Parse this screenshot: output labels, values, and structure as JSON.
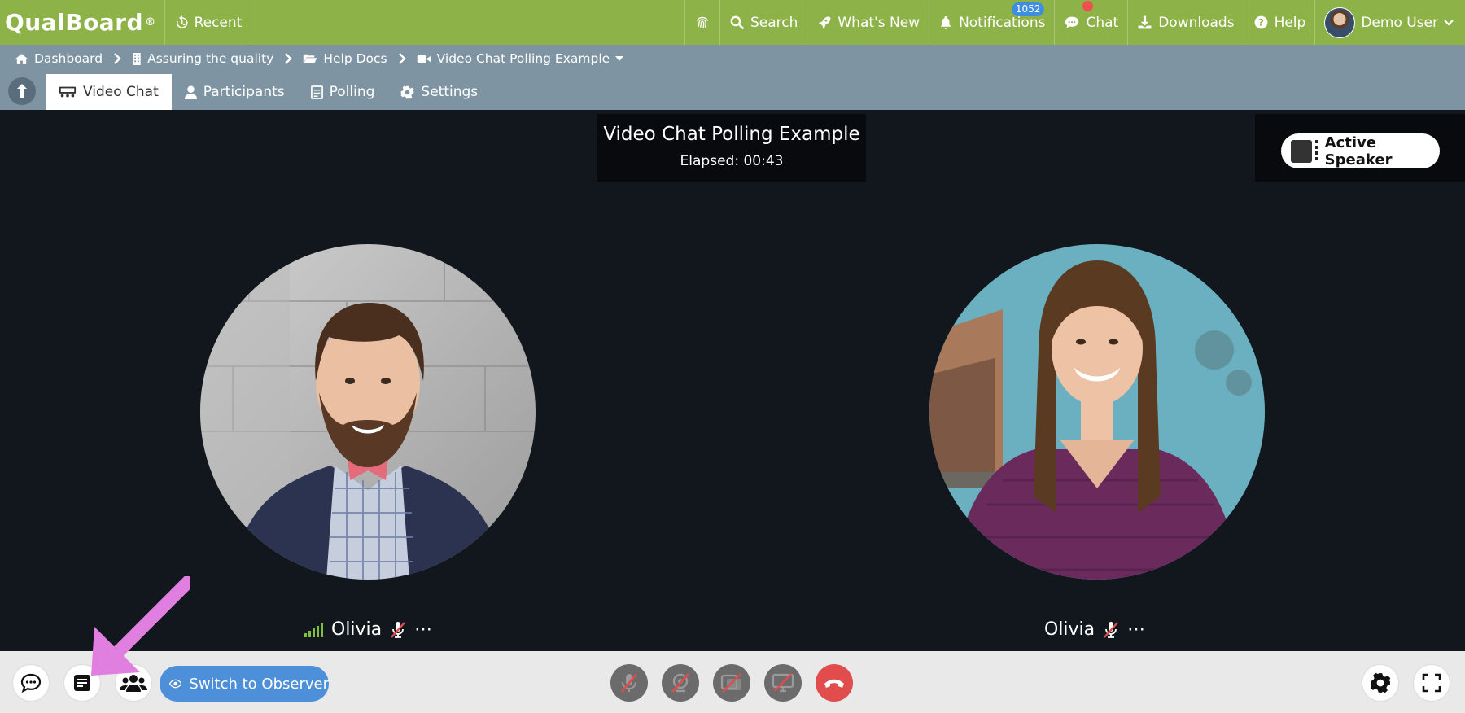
{
  "topbar": {
    "brand": "QualBoard",
    "brand_mark": "®",
    "recent": "Recent",
    "search": "Search",
    "whats_new": "What's New",
    "notifications": "Notifications",
    "notifications_count": "1052",
    "chat": "Chat",
    "downloads": "Downloads",
    "help": "Help",
    "user": "Demo User",
    "accent_color": "#8db247"
  },
  "breadcrumb": {
    "items": [
      "Dashboard",
      "Assuring the quality",
      "Help Docs",
      "Video Chat Polling Example"
    ]
  },
  "tabs": [
    {
      "label": "Video Chat",
      "active": true
    },
    {
      "label": "Participants",
      "active": false
    },
    {
      "label": "Polling",
      "active": false
    },
    {
      "label": "Settings",
      "active": false
    }
  ],
  "session": {
    "title": "Video Chat Polling Example",
    "elapsed": "Elapsed: 00:43",
    "active_speaker_label": "Active Speaker"
  },
  "participants": [
    {
      "name": "Olivia",
      "muted": true,
      "signal": "strong"
    },
    {
      "name": "Olivia",
      "muted": true
    }
  ],
  "more_glyph": "⋯",
  "toolbar": {
    "switch_observer": "Switch to Observer",
    "observer_color": "#4d8fd9",
    "hangup_color": "#e14c4c"
  },
  "annotation": {
    "arrow_color": "#e07fe0",
    "points_to": "polling-button"
  }
}
